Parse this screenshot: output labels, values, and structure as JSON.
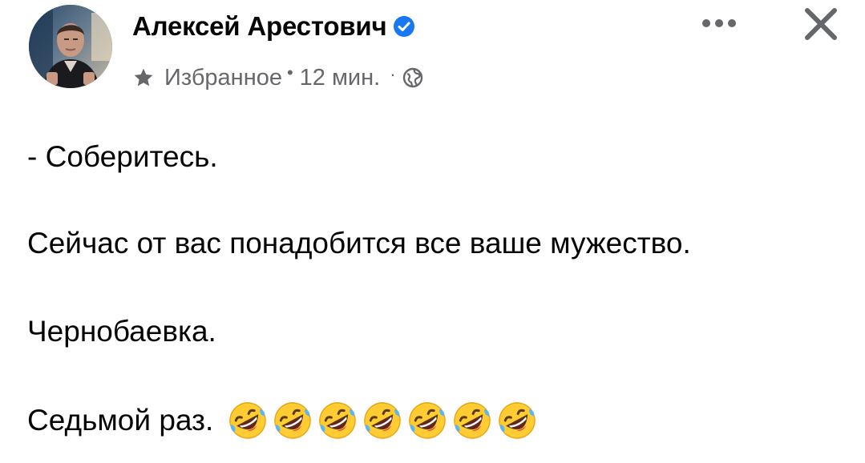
{
  "post": {
    "author_name": "Алексей Арестович",
    "verified": true,
    "audience_label": "Избранное",
    "time_ago": "12 мин.",
    "separator_1": "•",
    "separator_2": "·",
    "lines": [
      "- Соберитесь.",
      "Сейчас от вас понадобится все ваше мужество.",
      "Чернобаевка.",
      "Седьмой раз."
    ],
    "emoji_count": 7,
    "emoji_name": "rolling-on-the-floor-laughing"
  },
  "icons": {
    "verified": "verified-badge-icon",
    "star": "star-icon",
    "globe": "globe-icon",
    "more": "more-options-icon",
    "close": "close-icon"
  },
  "colors": {
    "text_primary": "#050505",
    "text_secondary": "#65676b",
    "verified_blue": "#1877f2",
    "icon_gray": "#65676b"
  }
}
